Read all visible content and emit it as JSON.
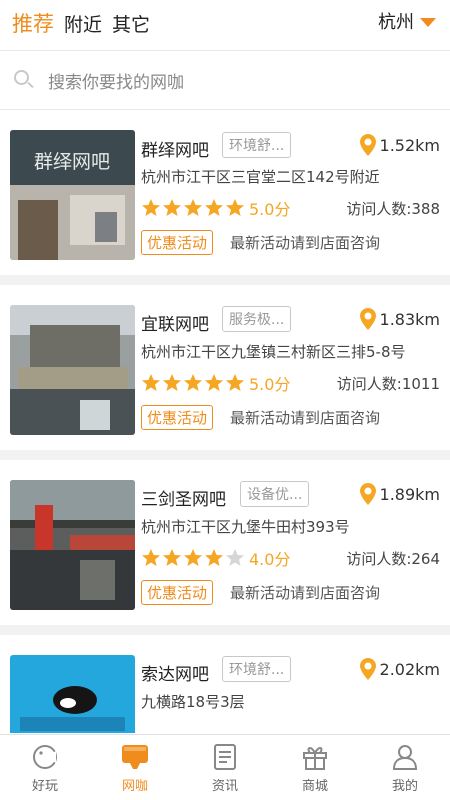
{
  "header": {
    "tabs": [
      "推荐",
      "附近",
      "其它"
    ],
    "active_tab": 0,
    "city": "杭州"
  },
  "search": {
    "placeholder": "搜索你要找的网咖"
  },
  "shops": [
    {
      "name": "群绎网吧",
      "tag": "环境舒...",
      "distance": "1.52km",
      "address": "杭州市江干区三官堂二区142号附近",
      "rating": 5,
      "score": "5.0分",
      "visitors": "访问人数:388",
      "promo_label": "优惠活动",
      "promo_text": "最新活动请到店面咨询",
      "thumb_sign": "群绎网吧"
    },
    {
      "name": "宜联网吧",
      "tag": "服务极...",
      "distance": "1.83km",
      "address": "杭州市江干区九堡镇三村新区三排5-8号",
      "rating": 5,
      "score": "5.0分",
      "visitors": "访问人数:1011",
      "promo_label": "优惠活动",
      "promo_text": "最新活动请到店面咨询",
      "thumb_sign": ""
    },
    {
      "name": "三剑圣网吧",
      "tag": "设备优...",
      "distance": "1.89km",
      "address": "杭州市江干区九堡牛田村393号",
      "rating": 4,
      "score": "4.0分",
      "visitors": "访问人数:264",
      "promo_label": "优惠活动",
      "promo_text": "最新活动请到店面咨询",
      "thumb_sign": ""
    },
    {
      "name": "索达网吧",
      "tag": "环境舒...",
      "distance": "2.02km",
      "address": "九横路18号3层",
      "rating": 0,
      "score": "",
      "visitors": "",
      "promo_label": "",
      "promo_text": "",
      "thumb_sign": ""
    }
  ],
  "bottom_nav": [
    {
      "label": "好玩",
      "icon": "play-icon"
    },
    {
      "label": "网咖",
      "icon": "monitor-icon"
    },
    {
      "label": "资讯",
      "icon": "news-icon"
    },
    {
      "label": "商城",
      "icon": "gift-icon"
    },
    {
      "label": "我的",
      "icon": "profile-icon"
    }
  ],
  "active_nav": 1,
  "colors": {
    "accent": "#f08c1e",
    "star": "#f5a623",
    "star_off": "#d6d6d6"
  }
}
